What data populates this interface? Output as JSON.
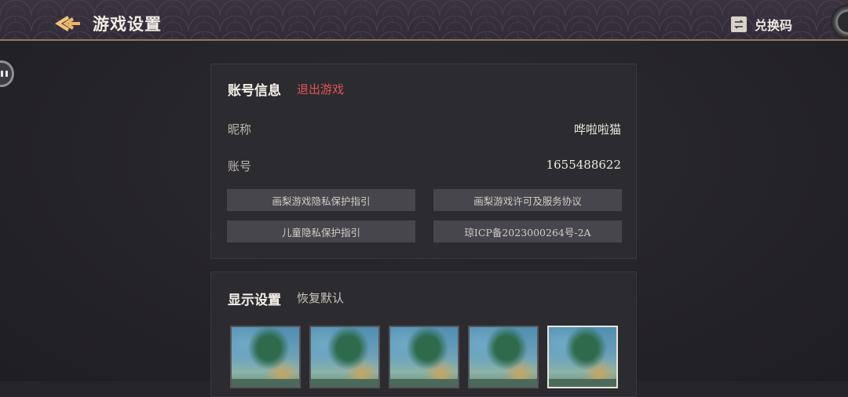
{
  "header": {
    "title": "游戏设置",
    "redeem_label": "兑换码"
  },
  "account": {
    "section_title": "账号信息",
    "logout_label": "退出游戏",
    "rows": [
      {
        "label": "昵称",
        "value": "哗啦啦猫"
      },
      {
        "label": "账号",
        "value": "1655488622"
      }
    ],
    "links": [
      "画梨游戏隐私保护指引",
      "画梨游戏许可及服务协议",
      "儿童隐私保护指引",
      "琼ICP备2023000264号-2A"
    ]
  },
  "display": {
    "section_title": "显示设置",
    "restore_label": "恢复默认",
    "thumbnails_count": 5,
    "selected_index": 4
  },
  "colors": {
    "accent_gold": "#e8b76a",
    "logout_red": "#e05454",
    "panel_bg": "#2c2b30"
  }
}
